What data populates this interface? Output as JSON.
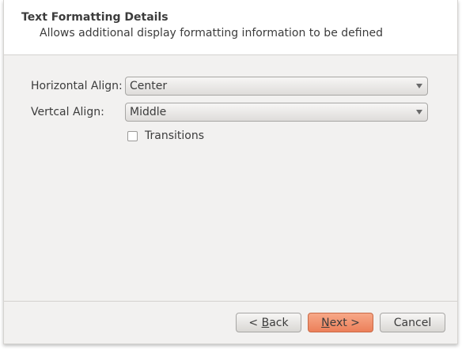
{
  "header": {
    "title": "Text Formatting Details",
    "subtitle": "Allows additional display formatting information to be defined"
  },
  "form": {
    "horizontal_label": "Horizontal Align:",
    "horizontal_value": "Center",
    "vertical_label": "Vertcal Align:",
    "vertical_value": "Middle",
    "transitions_label": "Transitions",
    "transitions_checked": false
  },
  "buttons": {
    "back_prefix": "< ",
    "back_mnemonic": "B",
    "back_rest": "ack",
    "next_mnemonic": "N",
    "next_rest": "ext >",
    "cancel": "Cancel"
  },
  "icons": {
    "combo_arrow": "chevron-down-icon"
  },
  "colors": {
    "primary_button": "#ec805a",
    "dialog_bg": "#f2f1f0"
  }
}
